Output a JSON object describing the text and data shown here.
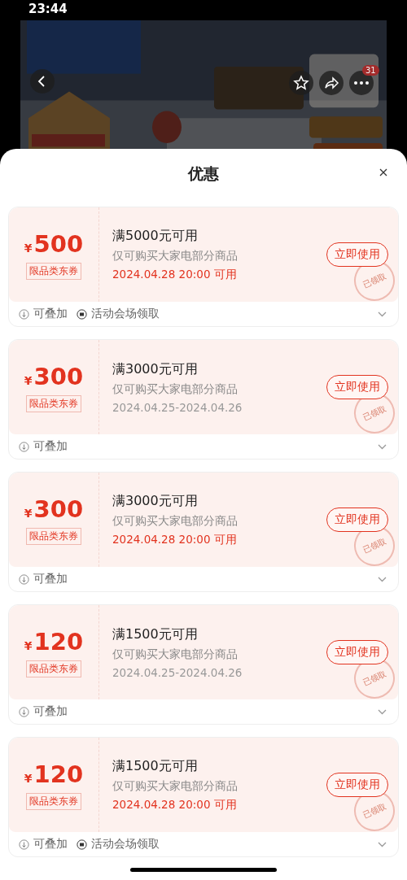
{
  "status_bar": {
    "time": "23:44"
  },
  "product_header": {
    "cart_count": "31"
  },
  "sheet": {
    "title": "优惠"
  },
  "coupons": [
    {
      "currency": "¥",
      "amount": "500",
      "type_label": "限品类东券",
      "threshold": "满5000元可用",
      "scope": "仅可购买大家电部分商品",
      "validity": "2024.04.28 20:00 可用",
      "validity_highlight": true,
      "button": "立即使用",
      "stamp": "已领取",
      "tags": [
        {
          "kind": "stackable",
          "label": "可叠加"
        },
        {
          "kind": "venue",
          "label": "活动会场领取"
        }
      ]
    },
    {
      "currency": "¥",
      "amount": "300",
      "type_label": "限品类东券",
      "threshold": "满3000元可用",
      "scope": "仅可购买大家电部分商品",
      "validity": "2024.04.25-2024.04.26",
      "validity_highlight": false,
      "button": "立即使用",
      "stamp": "已领取",
      "tags": [
        {
          "kind": "stackable",
          "label": "可叠加"
        }
      ]
    },
    {
      "currency": "¥",
      "amount": "300",
      "type_label": "限品类东券",
      "threshold": "满3000元可用",
      "scope": "仅可购买大家电部分商品",
      "validity": "2024.04.28 20:00 可用",
      "validity_highlight": true,
      "button": "立即使用",
      "stamp": "已领取",
      "tags": [
        {
          "kind": "stackable",
          "label": "可叠加"
        }
      ]
    },
    {
      "currency": "¥",
      "amount": "120",
      "type_label": "限品类东券",
      "threshold": "满1500元可用",
      "scope": "仅可购买大家电部分商品",
      "validity": "2024.04.25-2024.04.26",
      "validity_highlight": false,
      "button": "立即使用",
      "stamp": "已领取",
      "tags": [
        {
          "kind": "stackable",
          "label": "可叠加"
        }
      ]
    },
    {
      "currency": "¥",
      "amount": "120",
      "type_label": "限品类东券",
      "threshold": "满1500元可用",
      "scope": "仅可购买大家电部分商品",
      "validity": "2024.04.28 20:00 可用",
      "validity_highlight": true,
      "button": "立即使用",
      "stamp": "已领取",
      "tags": [
        {
          "kind": "stackable",
          "label": "可叠加"
        },
        {
          "kind": "venue",
          "label": "活动会场领取"
        }
      ]
    }
  ]
}
